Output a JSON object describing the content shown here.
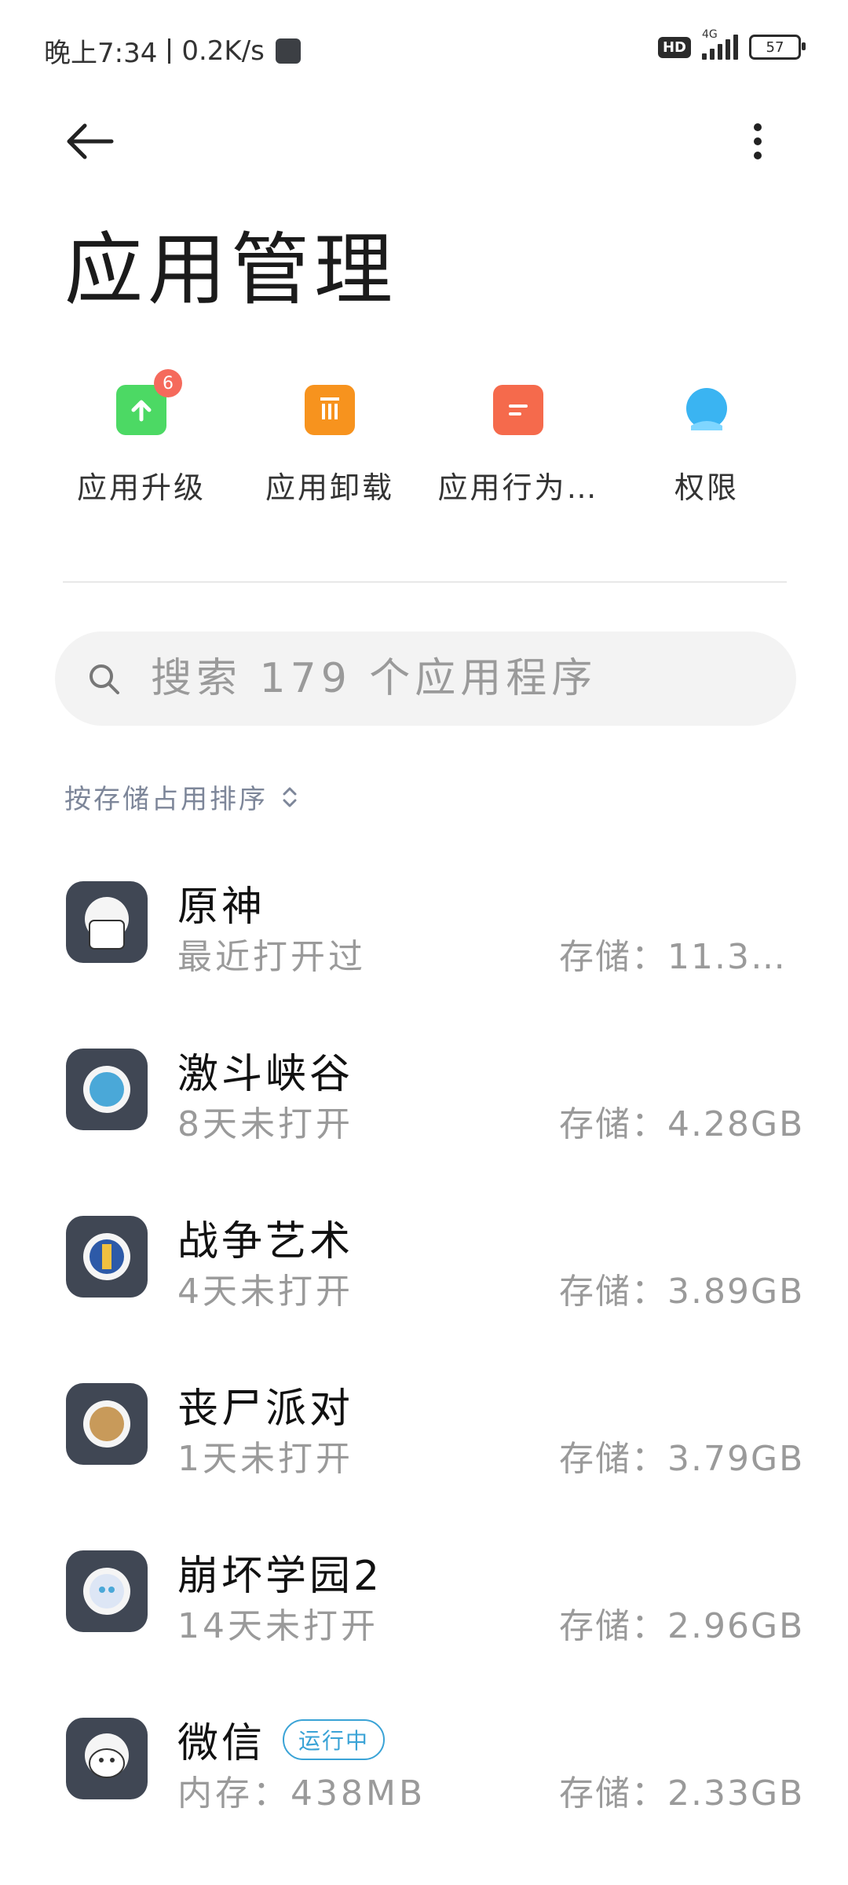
{
  "status_bar": {
    "time": "晚上7:34",
    "speed": "0.2K/s",
    "hd": "HD",
    "network": "4G",
    "battery": "57"
  },
  "header": {
    "title": "应用管理"
  },
  "quick_actions": [
    {
      "label": "应用升级",
      "badge": "6",
      "icon": "upgrade-icon",
      "color": "#4cd964"
    },
    {
      "label": "应用卸载",
      "icon": "trash-icon",
      "color": "#f7931e"
    },
    {
      "label": "应用行为…",
      "icon": "behavior-icon",
      "color": "#f56a4c"
    },
    {
      "label": "权限",
      "icon": "permission-icon",
      "color": "#3ab4f2"
    }
  ],
  "search": {
    "placeholder": "搜索 179 个应用程序"
  },
  "sort": {
    "label": "按存储占用排序"
  },
  "apps": [
    {
      "name": "原神",
      "sub": "最近打开过",
      "storage": "存储：11.3…"
    },
    {
      "name": "激斗峡谷",
      "sub": "8天未打开",
      "storage": "存储：4.28GB"
    },
    {
      "name": "战争艺术",
      "sub": "4天未打开",
      "storage": "存储：3.89GB"
    },
    {
      "name": "丧尸派对",
      "sub": "1天未打开",
      "storage": "存储：3.79GB"
    },
    {
      "name": "崩坏学园2",
      "sub": "14天未打开",
      "storage": "存储：2.96GB"
    },
    {
      "name": "微信",
      "tag": "运行中",
      "sub": "内存：438MB",
      "storage": "存储：2.33GB"
    }
  ]
}
